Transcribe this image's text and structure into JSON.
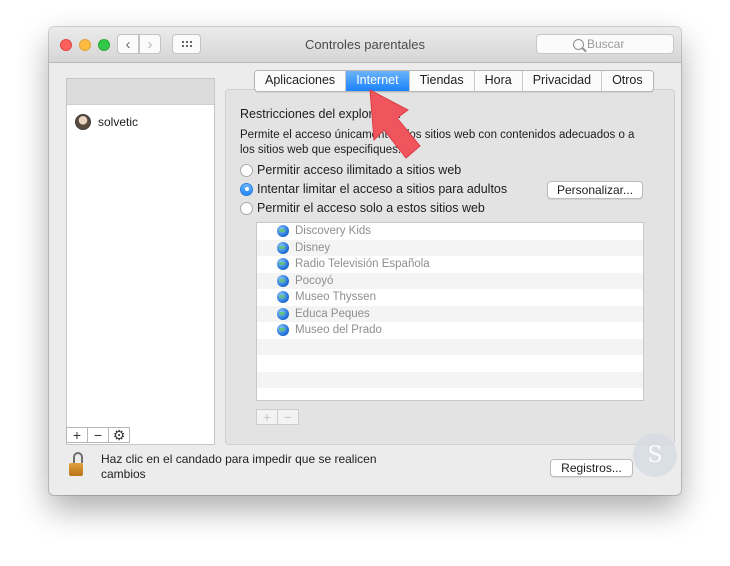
{
  "window": {
    "title": "Controles parentales"
  },
  "toolbar": {
    "back_icon": "chevron-left-icon",
    "forward_icon": "chevron-right-icon",
    "show_all_icon": "grid-icon"
  },
  "search": {
    "placeholder": "Buscar"
  },
  "users": {
    "items": [
      {
        "name": "solvetic"
      }
    ],
    "controls": {
      "add": "+",
      "remove": "−",
      "settings": "⚙"
    }
  },
  "tabs": [
    {
      "label": "Aplicaciones",
      "active": false
    },
    {
      "label": "Internet",
      "active": true
    },
    {
      "label": "Tiendas",
      "active": false
    },
    {
      "label": "Hora",
      "active": false
    },
    {
      "label": "Privacidad",
      "active": false
    },
    {
      "label": "Otros",
      "active": false
    }
  ],
  "internet": {
    "section_title": "Restricciones del explorador:",
    "description": "Permite el acceso únicamente a los sitios web con contenidos adecuados o a los sitios web que especifiques.",
    "options": [
      {
        "label": "Permitir acceso ilimitado a sitios web",
        "selected": false
      },
      {
        "label": "Intentar limitar el acceso a sitios para adultos",
        "selected": true
      },
      {
        "label": "Permitir el acceso solo a estos sitios web",
        "selected": false
      }
    ],
    "customize_label": "Personalizar...",
    "sites": [
      "Discovery Kids",
      "Disney",
      "Radio Televisión Española",
      "Pocoyó",
      "Museo Thyssen",
      "Educa Peques",
      "Museo del Prado"
    ],
    "site_controls": {
      "add": "+",
      "remove": "−"
    }
  },
  "footer": {
    "lock_text": "Haz clic en el candado para impedir que se realicen cambios",
    "logs_label": "Registros..."
  },
  "colors": {
    "accent": "#1a82fb",
    "arrow": "#f0545c"
  }
}
